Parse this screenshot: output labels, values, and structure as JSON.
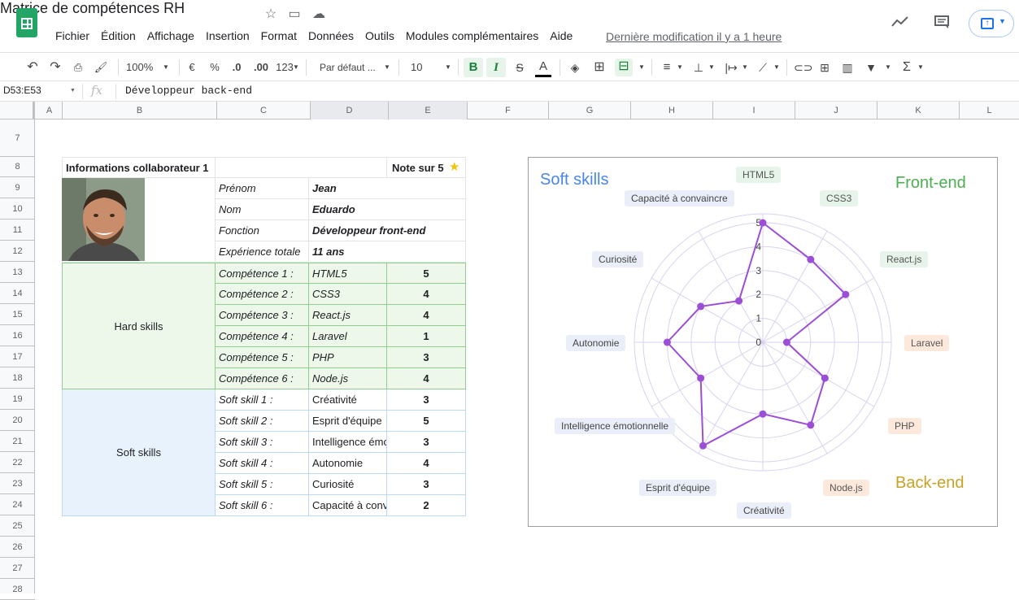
{
  "app": {
    "title": "Matrice de compétences RH",
    "last_modified": "Dernière modification il y a 1 heure",
    "menus": [
      "Fichier",
      "Édition",
      "Affichage",
      "Insertion",
      "Format",
      "Données",
      "Outils",
      "Modules complémentaires",
      "Aide"
    ]
  },
  "toolbar": {
    "zoom": "100%",
    "currency": "€",
    "percent": "%",
    "dec_minus": ".0",
    "dec_plus": ".00",
    "format_more": "123",
    "font": "Par défaut ...",
    "font_size": "10",
    "bold": "B",
    "italic": "I",
    "strike": "S",
    "text_color": "A"
  },
  "formula": {
    "namebox": "D53:E53",
    "fx": "fx",
    "content": "Développeur back-end"
  },
  "columns": [
    "A",
    "B",
    "C",
    "D",
    "E",
    "F",
    "G",
    "H",
    "I",
    "J",
    "K",
    "L"
  ],
  "rows": [
    "7",
    "8",
    "9",
    "10",
    "11",
    "12",
    "13",
    "14",
    "15",
    "16",
    "17",
    "18",
    "19",
    "20",
    "21",
    "22",
    "23",
    "24",
    "25",
    "26",
    "27",
    "28"
  ],
  "sheet": {
    "header_title": "Informations collaborateur 1",
    "header_note": "Note sur 5",
    "info": [
      {
        "label": "Prénom",
        "value": "Jean"
      },
      {
        "label": "Nom",
        "value": "Eduardo"
      },
      {
        "label": "Fonction",
        "value": "Développeur front-end"
      },
      {
        "label": "Expérience totale",
        "value": "11 ans"
      }
    ],
    "hard_label": "Hard skills",
    "hard": [
      {
        "label": "Compétence 1 :",
        "skill": "HTML5",
        "score": "5"
      },
      {
        "label": "Compétence 2 :",
        "skill": "CSS3",
        "score": "4"
      },
      {
        "label": "Compétence 3 :",
        "skill": "React.js",
        "score": "4"
      },
      {
        "label": "Compétence 4 :",
        "skill": "Laravel",
        "score": "1"
      },
      {
        "label": "Compétence 5 :",
        "skill": "PHP",
        "score": "3"
      },
      {
        "label": "Compétence 6 :",
        "skill": "Node.js",
        "score": "4"
      }
    ],
    "soft_label": "Soft skills",
    "soft": [
      {
        "label": "Soft skill 1 :",
        "skill": "Créativité",
        "score": "3"
      },
      {
        "label": "Soft skill 2 :",
        "skill": "Esprit d'équipe",
        "score": "5"
      },
      {
        "label": "Soft skill 3 :",
        "skill": "Intelligence émo",
        "score": "3"
      },
      {
        "label": "Soft skill 4 :",
        "skill": "Autonomie",
        "score": "4"
      },
      {
        "label": "Soft skill 5 :",
        "skill": "Curiosité",
        "score": "3"
      },
      {
        "label": "Soft skill 6 :",
        "skill": "Capacité à conv",
        "score": "2"
      }
    ]
  },
  "chart_data": {
    "type": "radar",
    "ticks": [
      "0",
      "1",
      "2",
      "3",
      "4",
      "5"
    ],
    "rmax": 5,
    "categories": [
      "HTML5",
      "CSS3",
      "React.js",
      "Laravel",
      "PHP",
      "Node.js",
      "Créativité",
      "Esprit d'équipe",
      "Intelligence émotionnelle",
      "Autonomie",
      "Curiosité",
      "Capacité à convaincre"
    ],
    "values": [
      5,
      4,
      4,
      1,
      3,
      4,
      3,
      5,
      3,
      4,
      3,
      2
    ],
    "group_titles": {
      "soft": "Soft skills",
      "front": "Front-end",
      "back": "Back-end"
    },
    "colors": {
      "line": "#9c4fd6",
      "grid": "#d9d2ee",
      "soft": "#4a86e8",
      "front": "#4caf50",
      "back": "#c9a227"
    }
  }
}
